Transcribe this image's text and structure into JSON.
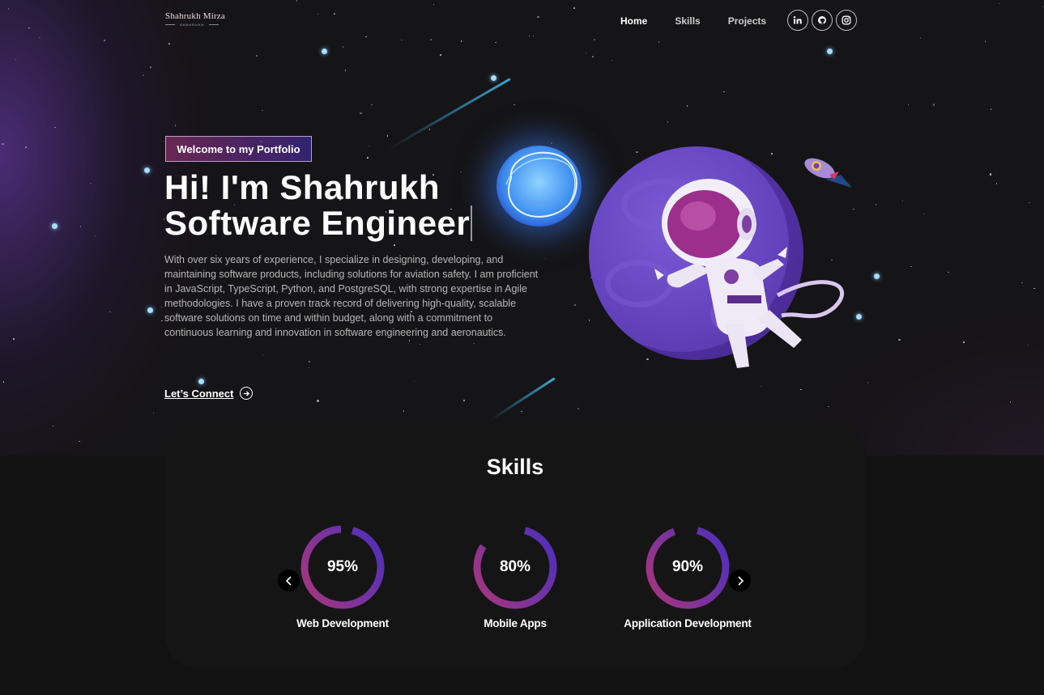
{
  "logo": {
    "name": "Shahrukh Mirza",
    "tagline": "SHAHRUKH"
  },
  "nav": {
    "items": [
      "Home",
      "Skills",
      "Projects"
    ],
    "active": "Home"
  },
  "socials": {
    "icons": [
      "linkedin-icon",
      "github-icon",
      "instagram-icon"
    ]
  },
  "hero": {
    "tagline": "Welcome to my Portfolio",
    "headline_line1": "Hi! I'm Shahrukh",
    "headline_line2": "Software Engineer",
    "bio": "With over six years of experience, I specialize in designing, developing, and maintaining software products, including solutions for aviation safety. I am proficient in JavaScript, TypeScript, Python, and PostgreSQL, with strong expertise in Agile methodologies. I have a proven track record of delivering high-quality, scalable software solutions on time and within budget, along with a commitment to continuous learning and innovation in software engineering and aeronautics.",
    "cta_label": "Let’s Connect"
  },
  "skills": {
    "title": "Skills",
    "items": [
      {
        "label": "Web Development",
        "percent_text": "95%",
        "percent": 95
      },
      {
        "label": "Mobile Apps",
        "percent_text": "80%",
        "percent": 80
      },
      {
        "label": "Application Development",
        "percent_text": "90%",
        "percent": 90
      }
    ]
  },
  "colors": {
    "accent_pink": "#AA367C",
    "accent_purple": "#4A2FBD",
    "background": "#121212"
  }
}
